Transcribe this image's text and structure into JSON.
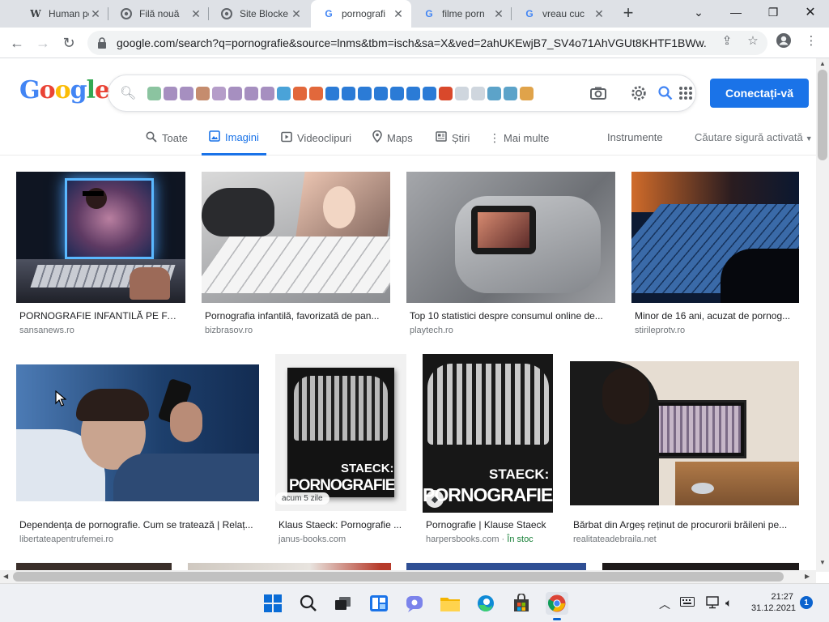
{
  "browser": {
    "tabs": [
      {
        "title": "Human pe",
        "favicon": "W",
        "favicon_name": "wikipedia-icon"
      },
      {
        "title": "Filă nouă",
        "favicon": "◉",
        "favicon_name": "chrome-icon"
      },
      {
        "title": "Site Blocke",
        "favicon": "◉",
        "favicon_name": "chrome-icon"
      },
      {
        "title": "pornografi",
        "favicon": "G",
        "favicon_name": "google-icon",
        "active": true
      },
      {
        "title": "filme porn",
        "favicon": "G",
        "favicon_name": "google-icon"
      },
      {
        "title": "vreau cuc",
        "favicon": "G",
        "favicon_name": "google-icon"
      }
    ],
    "url": "google.com/search?q=pornografie&source=lnms&tbm=isch&sa=X&ved=2ahUKEwjB7_SV4o71AhVGUt8KHTF1BWw..."
  },
  "google": {
    "logo": "Google",
    "signin_label": "Conectați-vă",
    "tabs": [
      {
        "label": "Toate",
        "icon": "search-icon"
      },
      {
        "label": "Imagini",
        "icon": "images-icon",
        "active": true
      },
      {
        "label": "Videoclipuri",
        "icon": "video-icon"
      },
      {
        "label": "Maps",
        "icon": "map-pin-icon"
      },
      {
        "label": "Știri",
        "icon": "news-icon"
      },
      {
        "label": "Mai multe",
        "icon": "more-vert-icon"
      }
    ],
    "tools_label": "Instrumente",
    "safesearch_label": "Căutare sigură activată"
  },
  "results": [
    {
      "caption": "PORNOGRAFIE INFANTILĂ PE FAC...",
      "source": "sansanews.ro"
    },
    {
      "caption": "Pornografia infantilă, favorizată de pan...",
      "source": "bizbrasov.ro"
    },
    {
      "caption": "Top 10 statistici despre consumul online de...",
      "source": "playtech.ro"
    },
    {
      "caption": "Minor de 16 ani, acuzat de pornog...",
      "source": "stirileprotv.ro"
    },
    {
      "caption": "Dependența de pornografie. Cum se tratează | Relaț...",
      "source": "libertateapentrufemei.ro"
    },
    {
      "caption": "Klaus Staeck: Pornografie ...",
      "source": "janus-books.com",
      "badge": "acum 5 zile"
    },
    {
      "caption": "Pornografie | Klause Staeck",
      "source": "harpersbooks.com",
      "stock": "În stoc"
    },
    {
      "caption": "Bărbat din Argeș reținut de procurorii brăileni pe...",
      "source": "realitateadebraila.net"
    }
  ],
  "posters": {
    "line1": "STAECK:",
    "line2": "PORNOGRAFIE"
  },
  "taskbar": {
    "time": "21:27",
    "date": "31.12.2021",
    "notifications": "1"
  }
}
